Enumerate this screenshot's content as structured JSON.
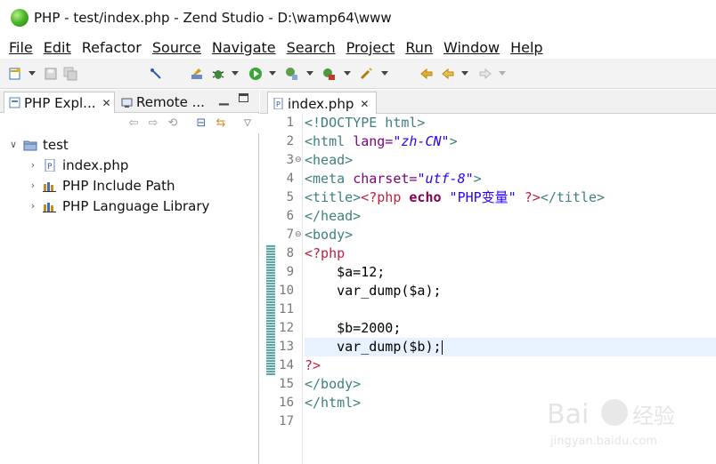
{
  "window": {
    "title": "PHP - test/index.php - Zend Studio - D:\\wamp64\\www"
  },
  "menu": [
    "File",
    "Edit",
    "Refactor",
    "Source",
    "Navigate",
    "Search",
    "Project",
    "Run",
    "Window",
    "Help"
  ],
  "left_panel": {
    "tabs": [
      {
        "label": "PHP Expl..."
      },
      {
        "label": "Remote ..."
      }
    ],
    "tree": [
      {
        "label": "test",
        "icon": "project-folder-icon"
      },
      {
        "label": "index.php",
        "icon": "php-file-icon"
      },
      {
        "label": "PHP Include Path",
        "icon": "library-icon"
      },
      {
        "label": "PHP Language Library",
        "icon": "library-icon"
      }
    ]
  },
  "editor": {
    "tab_label": "index.php",
    "line_numbers": [
      "1",
      "2",
      "3",
      "4",
      "5",
      "6",
      "7",
      "8",
      "9",
      "10",
      "11",
      "12",
      "13",
      "14",
      "15",
      "16",
      "17"
    ],
    "current_line": 13,
    "tokens": {
      "l1": "<!DOCTYPE html>",
      "l2_a": "<html ",
      "l2_b": "lang=",
      "l2_c": "\"zh-CN\"",
      "l2_d": ">",
      "l3": "<head>",
      "l4_a": "<meta ",
      "l4_b": "charset=",
      "l4_c": "\"utf-8\"",
      "l4_d": ">",
      "l5_a": "<title>",
      "l5_b": "<?php ",
      "l5_c": "echo",
      "l5_d": " \"PHP变量\" ",
      "l5_e": "?>",
      "l5_f": "</title>",
      "l6": "</head>",
      "l7": "<body>",
      "l8": "<?php",
      "l9": "    $a=12;",
      "l10": "    var_dump($a);",
      "l12": "    $b=2000;",
      "l13": "    var_dump($b);",
      "l14": "?>",
      "l15": "</body>",
      "l16": "</html>"
    }
  },
  "colors": {
    "tag": "#3f7f7f",
    "attribute": "#7f007f",
    "attribute_value": "#2a00ff",
    "php_delimiter": "#c02040",
    "keyword": "#7f0055",
    "current_line_bg": "#e8f2fe"
  },
  "watermark_text": "Bai 经验 jingyan.baidu.com"
}
